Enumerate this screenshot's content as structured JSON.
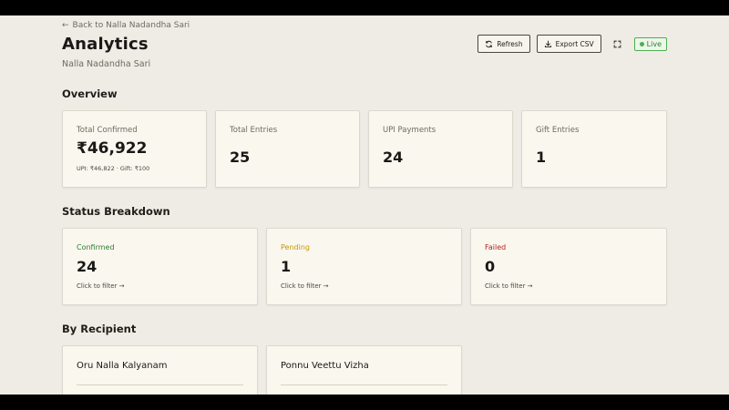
{
  "nav": {
    "back_label": "Back to Nalla Nadandha Sari"
  },
  "header": {
    "title": "Analytics",
    "subtitle": "Nalla Nadandha Sari",
    "refresh_label": "Refresh",
    "export_label": "Export CSV",
    "live_label": "Live"
  },
  "overview": {
    "heading": "Overview",
    "cards": [
      {
        "label": "Total Confirmed",
        "value": "₹46,922",
        "note": "UPI: ₹46,822 · Gift: ₹100"
      },
      {
        "label": "Total Entries",
        "value": "25"
      },
      {
        "label": "UPI Payments",
        "value": "24"
      },
      {
        "label": "Gift Entries",
        "value": "1"
      }
    ]
  },
  "status": {
    "heading": "Status Breakdown",
    "cards": [
      {
        "label": "Confirmed",
        "value": "24",
        "filter": "Click to filter →",
        "color": "#2e7d32"
      },
      {
        "label": "Pending",
        "value": "1",
        "filter": "Click to filter →",
        "color": "#c79a00"
      },
      {
        "label": "Failed",
        "value": "0",
        "filter": "Click to filter →",
        "color": "#b3261e"
      }
    ]
  },
  "recipients": {
    "heading": "By Recipient",
    "cards": [
      {
        "name": "Oru Nalla Kalyanam"
      },
      {
        "name": "Ponnu Veettu Vizha"
      }
    ]
  },
  "icons": {
    "back": "arrow-left-icon",
    "refresh": "refresh-icon",
    "export": "download-icon",
    "expand": "expand-icon",
    "live": "live-dot-icon"
  }
}
